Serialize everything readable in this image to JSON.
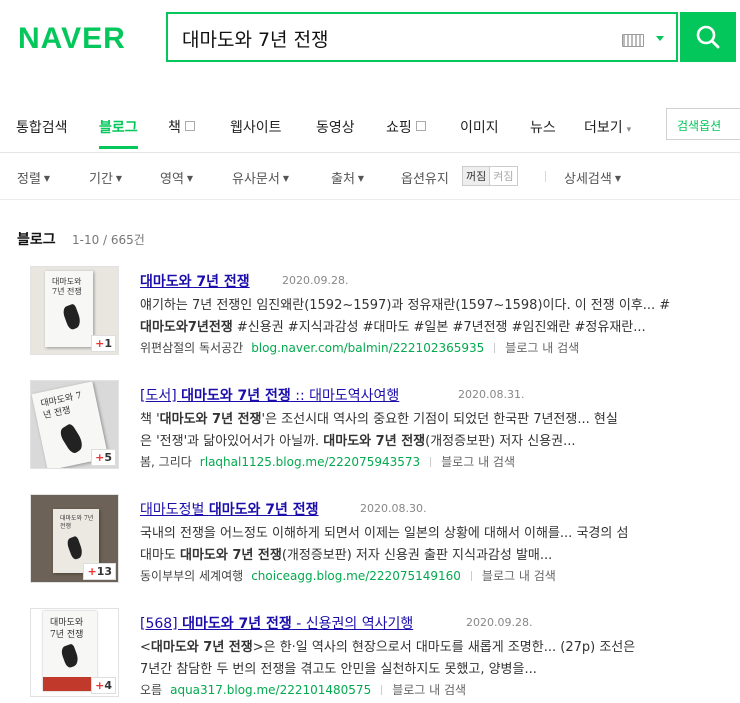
{
  "header": {
    "logo": "NAVER",
    "query": "대마도와 7년 전쟁",
    "brand_color": "#03c75a"
  },
  "tabs": [
    {
      "label": "통합검색"
    },
    {
      "label": "블로그",
      "active": true
    },
    {
      "label": "책"
    },
    {
      "label": "웹사이트"
    },
    {
      "label": "동영상"
    },
    {
      "label": "쇼핑"
    },
    {
      "label": "이미지"
    },
    {
      "label": "뉴스"
    },
    {
      "label": "더보기"
    }
  ],
  "search_options_label": "검색옵션",
  "filters": {
    "sort": "정렬",
    "period": "기간",
    "area": "영역",
    "similar": "유사문서",
    "source": "출처",
    "keep_option": "옵션유지",
    "off": "꺼짐",
    "on": "켜짐",
    "detail": "상세검색"
  },
  "results": {
    "section_title": "블로그",
    "count": "1-10 / 665건",
    "in_blog_label": "블로그 내 검색",
    "items": [
      {
        "title_pre": "",
        "title_bold": "대마도와 7년 전쟁",
        "title_post": "",
        "date": "2020.09.28.",
        "line1": "얘기하는 7년 전쟁인 임진왜란(1592~1597)과 정유재란(1597~1598)이다. 이 전쟁 이후... #",
        "line2_bold": "대마도와7년전쟁",
        "line2_rest": " #신용권 #지식과감성 #대마도 #일본 #7년전쟁 #임진왜란 #정유재란...",
        "author": "위편삼절의 독서공간",
        "url": "blog.naver.com/balmin/222102365935",
        "badge": "1"
      },
      {
        "title_pre": "[도서] ",
        "title_bold": "대마도와 7년 전쟁",
        "title_post": " :: 대마도역사여행",
        "date": "2020.08.31.",
        "line1_a": "책 '",
        "line1_bold": "대마도와 7년 전쟁",
        "line1_b": "'은 조선시대 역사의 중요한 기점이 되었던 한국판 7년전쟁... 현실",
        "line2_a": "은 '전쟁'과 닮아있어서가 아닐까. ",
        "line2_bold": "대마도와 7년 전쟁",
        "line2_b": "(개정증보판) 저자 신용권...",
        "author": "봄, 그리다",
        "url": "rlaqhal1125.blog.me/222075943573",
        "badge": "5"
      },
      {
        "title_pre": "대마도정벌 ",
        "title_bold": "대마도와 7년 전쟁",
        "title_post": "",
        "date": "2020.08.30.",
        "line1": "국내의 전쟁을 어느정도 이해하게 되면서 이제는 일본의 상황에 대해서 이해를... 국경의 섬",
        "line2_a": "대마도 ",
        "line2_bold": "대마도와 7년 전쟁",
        "line2_b": "(개정증보판) 저자 신용권 출판 지식과감성 발매...",
        "author": "동이부부의 세계여행",
        "url": "choiceagg.blog.me/222075149160",
        "badge": "13"
      },
      {
        "title_pre": "[568] ",
        "title_bold": "대마도와 7년 전쟁",
        "title_post": " - 신용권의 역사기행",
        "date": "2020.09.28.",
        "line1_a": "<",
        "line1_bold": "대마도와 7년 전쟁",
        "line1_b": ">은 한·일 역사의 현장으로서 대마도를 새롭게 조명한... (27p) 조선은",
        "line2": "7년간 참담한 두 번의 전쟁을 겪고도 안민을 실천하지도 못했고, 양병을...",
        "author": "오름",
        "url": "aqua317.blog.me/222101480575",
        "badge": "4"
      }
    ],
    "cover_text": "대마도와 7년 전쟁"
  }
}
